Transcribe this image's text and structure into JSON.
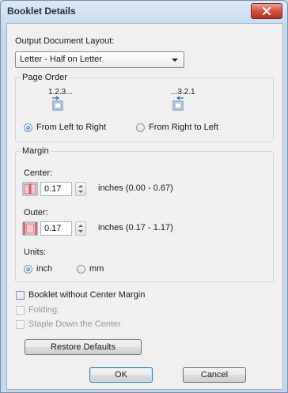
{
  "window": {
    "title": "Booklet Details",
    "close_icon": "close-icon"
  },
  "layout": {
    "label": "Output Document Layout:",
    "selected": "Letter - Half on Letter"
  },
  "page_order": {
    "legend": "Page Order",
    "left_seq": "1.2.3...",
    "right_seq": "...3.2.1",
    "left_label": "From Left to Right",
    "right_label": "From Right to Left",
    "selected": "left"
  },
  "margin": {
    "legend": "Margin",
    "center_label": "Center:",
    "center_value": "0.17",
    "center_range": "inches (0.00 - 0.67)",
    "outer_label": "Outer:",
    "outer_value": "0.17",
    "outer_range": "inches (0.17 - 1.17)",
    "units_label": "Units:",
    "unit_inch": "inch",
    "unit_mm": "mm",
    "selected_unit": "inch"
  },
  "options": {
    "without_center": "Booklet without Center Margin",
    "folding": "Folding:",
    "staple": "Staple Down the Center"
  },
  "buttons": {
    "restore": "Restore Defaults",
    "ok": "OK",
    "cancel": "Cancel"
  },
  "colors": {
    "accent": "#1e6fc7",
    "close": "#c7402b"
  }
}
